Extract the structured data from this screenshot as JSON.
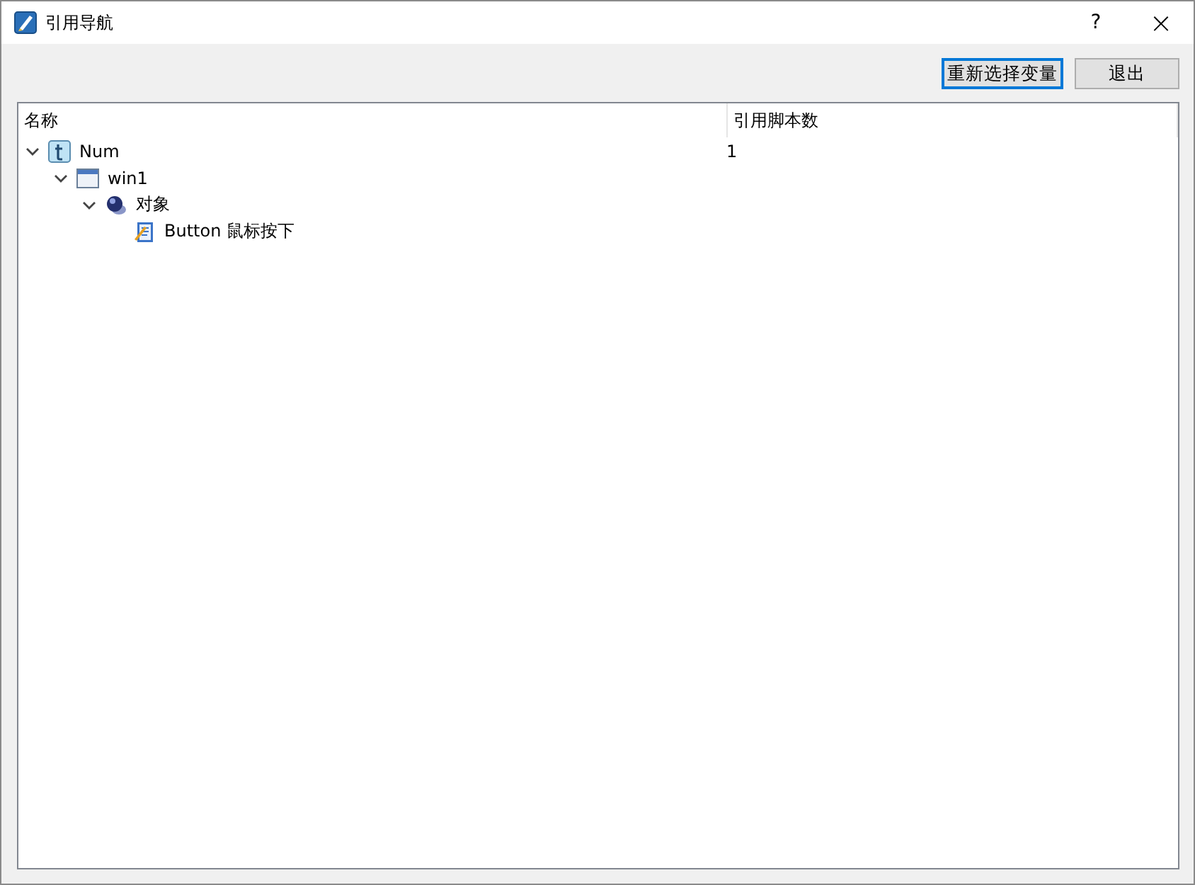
{
  "window": {
    "title": "引用导航",
    "help": "?",
    "close": "×"
  },
  "buttons": [
    {
      "label": "重新选择变量",
      "focused": true
    },
    {
      "label": "退出",
      "focused": false
    }
  ],
  "tree": {
    "columns": [
      "名称",
      "引用脚本数"
    ],
    "items": [
      {
        "kind": "variable",
        "name": "Num",
        "count": "1",
        "expanded": true,
        "children": [
          {
            "kind": "window",
            "name": "win1",
            "expanded": true,
            "children": [
              {
                "kind": "object",
                "name": "对象",
                "expanded": true,
                "children": [
                  {
                    "kind": "script",
                    "name": "Button 鼠标按下"
                  }
                ]
              }
            ]
          }
        ]
      }
    ]
  }
}
